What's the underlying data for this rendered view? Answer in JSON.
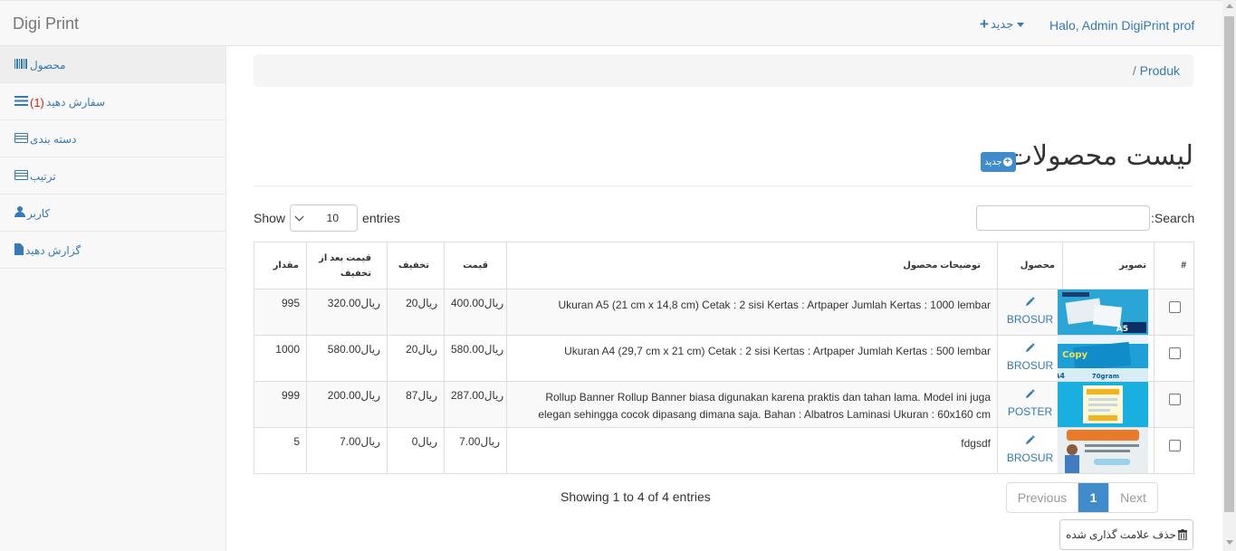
{
  "navbar": {
    "brand": "Digi Print",
    "new_label": "جدید",
    "user_label": "Halo, Admin DigiPrint",
    "user_suffix": "prof"
  },
  "sidebar": {
    "items": [
      {
        "label": "محصول",
        "icon": "barcode-icon"
      },
      {
        "label": "سفارش دهید",
        "count": "(1)",
        "icon": "bars-icon"
      },
      {
        "label": "دسته بندی",
        "icon": "list-icon"
      },
      {
        "label": "ترتیب",
        "icon": "list-icon"
      },
      {
        "label": "کاربر",
        "icon": "user-icon"
      },
      {
        "label": "گزارش دهید",
        "icon": "file-icon"
      }
    ]
  },
  "breadcrumb": {
    "separator": "/",
    "current": "Produk"
  },
  "page": {
    "title": "لیست محصولات",
    "new_button": "جدید",
    "show_label": "Show",
    "entries_label": "entries",
    "page_size": "10",
    "search_label": "Search:",
    "showing": "Showing 1 to 4 of 4 entries",
    "prev_label": "Previous",
    "current_page": "1",
    "next_label": "Next",
    "delete_button": "حذف علامت گذاری شده"
  },
  "table": {
    "headers": [
      "#",
      "تصویر",
      "محصول",
      "توضیحات محصول",
      "قیمت",
      "تخفیف",
      "قیمت بعد از تخفیف",
      "مقدار"
    ],
    "rows": [
      {
        "product": "BROSUR",
        "description": "Ukuran A5 (21 cm x 14,8 cm) Cetak : 2 sisi Kertas : Artpaper Jumlah Kertas : 1000 lembar",
        "price": "400.00ریال",
        "discount": "20ریال",
        "after": "320.00ریال",
        "qty": "995",
        "image": "brosur-a5-thumbnail"
      },
      {
        "product": "BROSUR",
        "description": "Ukuran A4 (29,7 cm x 21 cm) Cetak : 2 sisi Kertas : Artpaper Jumlah Kertas : 500 lembar",
        "price": "580.00ریال",
        "discount": "20ریال",
        "after": "580.00ریال",
        "qty": "1000",
        "image": "copy-paper-thumbnail"
      },
      {
        "product": "POSTER",
        "description": "Rollup Banner Rollup Banner biasa digunakan karena praktis dan tahan lama. Model ini juga elegan sehingga cocok dipasang dimana saja. Bahan : Albatros Laminasi Ukuran : 60x160 cm",
        "price": "287.00ریال",
        "discount": "87ریال",
        "after": "200.00ریال",
        "qty": "999",
        "image": "poster-thumbnail"
      },
      {
        "product": "BROSUR",
        "description": "fdgsdf",
        "price": "7.00ریال",
        "discount": "0ریال",
        "after": "7.00ریال",
        "qty": "5",
        "image": "banner-man-thumbnail"
      }
    ]
  },
  "colors": {
    "link": "#337ab7",
    "primary": "#428bca",
    "badge": "#d9230f"
  }
}
